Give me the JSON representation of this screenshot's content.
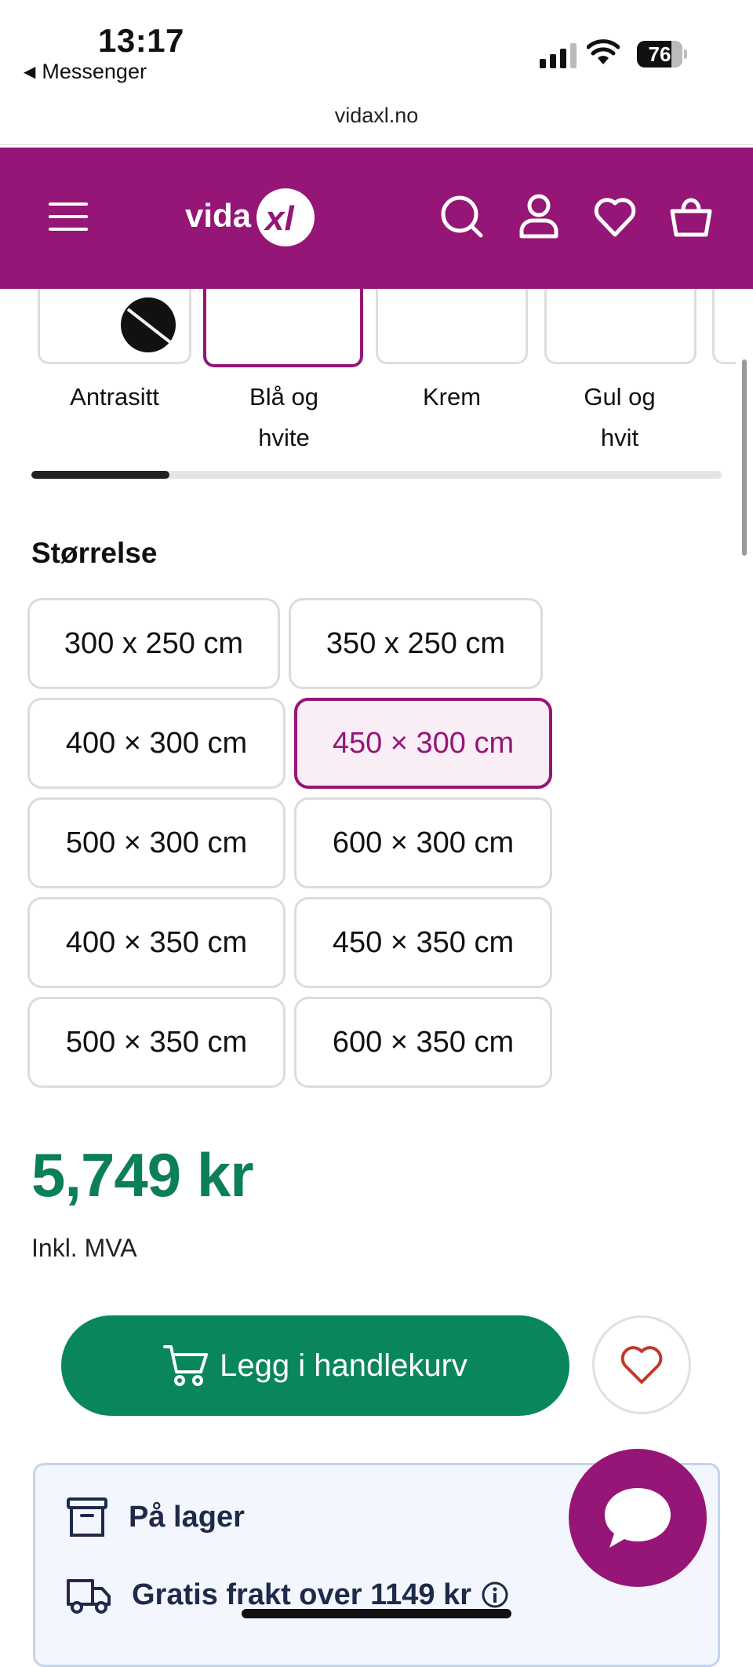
{
  "status_bar": {
    "time": "13:17",
    "back_label": "Messenger",
    "battery": "76"
  },
  "browser": {
    "url": "vidaxl.no"
  },
  "header": {
    "logo_text": "vidaXL"
  },
  "colors": {
    "items": [
      {
        "label": "Antrasitt"
      },
      {
        "label_line1": "Blå og",
        "label_line2": "hvite",
        "selected": true
      },
      {
        "label": "Krem"
      },
      {
        "label_line1": "Gul og",
        "label_line2": "hvit"
      }
    ]
  },
  "size": {
    "title": "Størrelse",
    "options": [
      {
        "label": "300 x 250 cm"
      },
      {
        "label": "350 x 250 cm"
      },
      {
        "label": "400 × 300 cm"
      },
      {
        "label": "450 × 300 cm",
        "selected": true
      },
      {
        "label": "500 × 300 cm"
      },
      {
        "label": "600 × 300 cm"
      },
      {
        "label": "400 × 350 cm"
      },
      {
        "label": "450 × 350 cm"
      },
      {
        "label": "500 × 350 cm"
      },
      {
        "label": "600 × 350 cm"
      }
    ]
  },
  "price": {
    "amount": "5,749 kr",
    "vat_note": "Inkl. MVA"
  },
  "actions": {
    "add_to_cart": "Legg i handlekurv"
  },
  "info": {
    "stock": "På lager",
    "shipping": "Gratis frakt over 1149 kr"
  },
  "theme": {
    "brand": "#951676",
    "accent_green": "#0a865c",
    "price_green": "#0a7f5a"
  }
}
